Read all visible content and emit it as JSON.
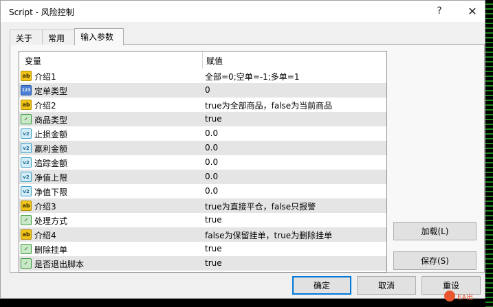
{
  "window": {
    "title": "Script - 风险控制",
    "help": "?",
    "close": "✕"
  },
  "tabs": [
    {
      "label": "关于"
    },
    {
      "label": "常用"
    },
    {
      "label": "输入参数"
    }
  ],
  "grid": {
    "col_variable": "变量",
    "col_value": "赋值",
    "rows": [
      {
        "icon": "ab",
        "name": "介绍1",
        "value": "全部=0;空单=-1;多单=1"
      },
      {
        "icon": "123",
        "name": "定单类型",
        "value": "0"
      },
      {
        "icon": "ab",
        "name": "介绍2",
        "value": "true为全部商品，false为当前商品"
      },
      {
        "icon": "bool",
        "name": "商品类型",
        "value": "true"
      },
      {
        "icon": "v2",
        "name": "止损金额",
        "value": "0.0"
      },
      {
        "icon": "v2",
        "name": "赢利金额",
        "value": "0.0"
      },
      {
        "icon": "v2",
        "name": "追踪金额",
        "value": "0.0"
      },
      {
        "icon": "v2",
        "name": "净值上限",
        "value": "0.0"
      },
      {
        "icon": "v2",
        "name": "净值下限",
        "value": "0.0"
      },
      {
        "icon": "ab",
        "name": "介绍3",
        "value": "true为直接平仓，false只报警"
      },
      {
        "icon": "bool",
        "name": "处理方式",
        "value": "true"
      },
      {
        "icon": "ab",
        "name": "介绍4",
        "value": "false为保留挂单，true为删除挂单"
      },
      {
        "icon": "bool",
        "name": "删除挂单",
        "value": "true"
      },
      {
        "icon": "bool",
        "name": "是否退出脚本",
        "value": "true"
      }
    ]
  },
  "buttons": {
    "load": "加载(L)",
    "save": "保存(S)",
    "ok": "确定",
    "cancel": "取消",
    "reset": "重设"
  },
  "watermark": "EA出"
}
